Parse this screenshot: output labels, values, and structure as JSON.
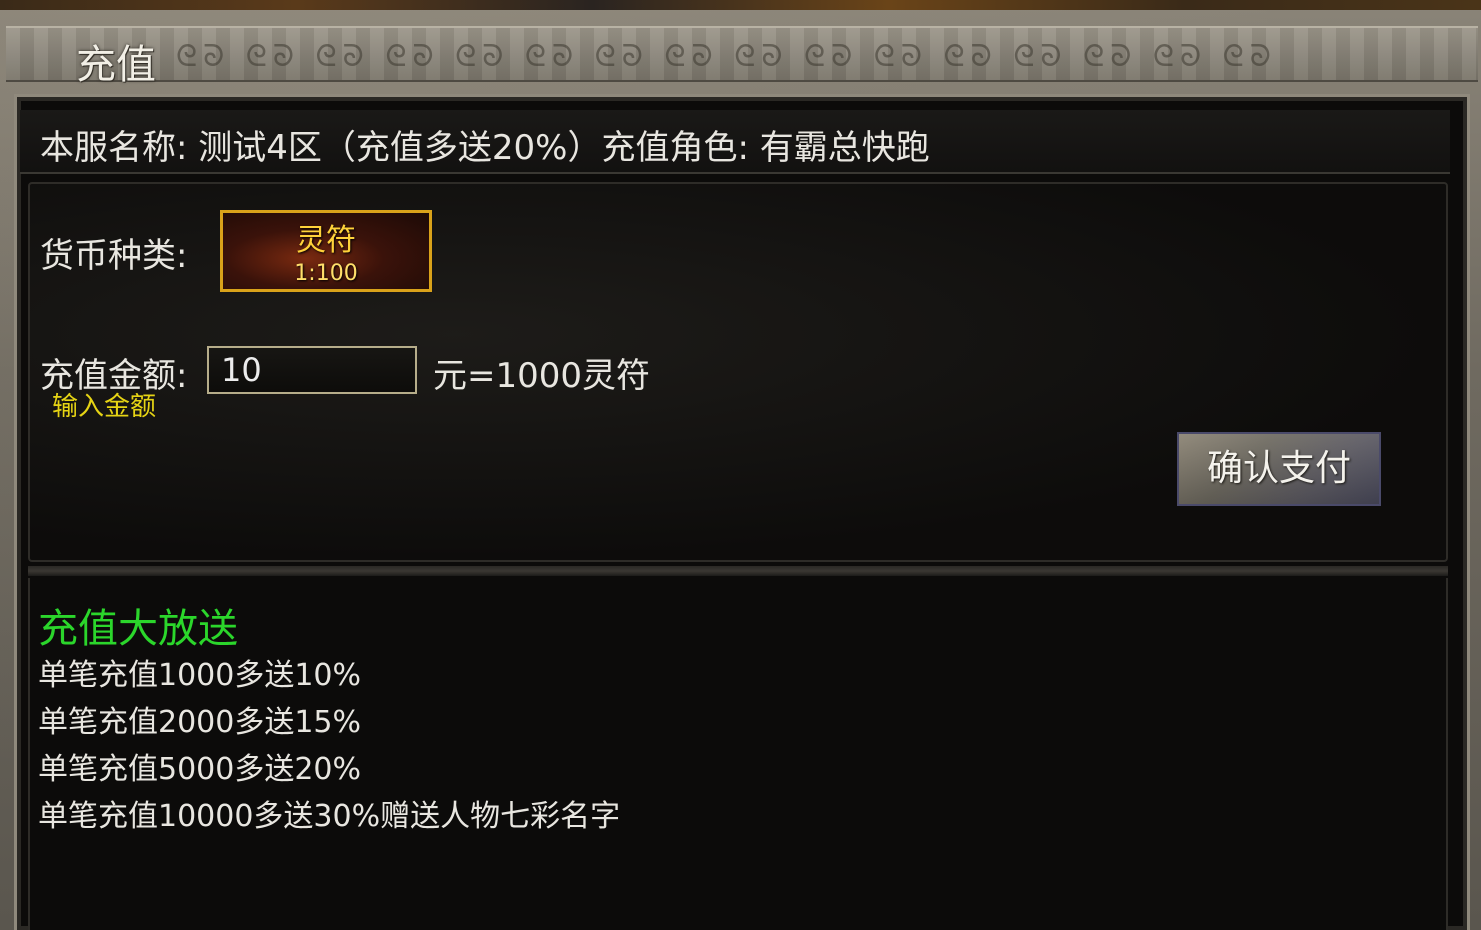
{
  "window": {
    "title": "充值"
  },
  "server": {
    "info": "本服名称: 测试4区（充值多送20%）充值角色: 有霸总快跑"
  },
  "currency": {
    "label": "货币种类:",
    "selected_name": "灵符",
    "selected_ratio": "1:100",
    "accent_color": "#d9a21a"
  },
  "amount": {
    "label": "充值金额:",
    "value": "10",
    "hint": "输入金额",
    "conversion": "元=1000灵符"
  },
  "confirm": {
    "label": "确认支付"
  },
  "promo": {
    "title": "充值大放送",
    "title_color": "#2bd62b",
    "items": [
      "单笔充值1000多送10%",
      "单笔充值2000多送15%",
      "单笔充值5000多送20%",
      "单笔充值10000多送30%赠送人物七彩名字"
    ]
  }
}
